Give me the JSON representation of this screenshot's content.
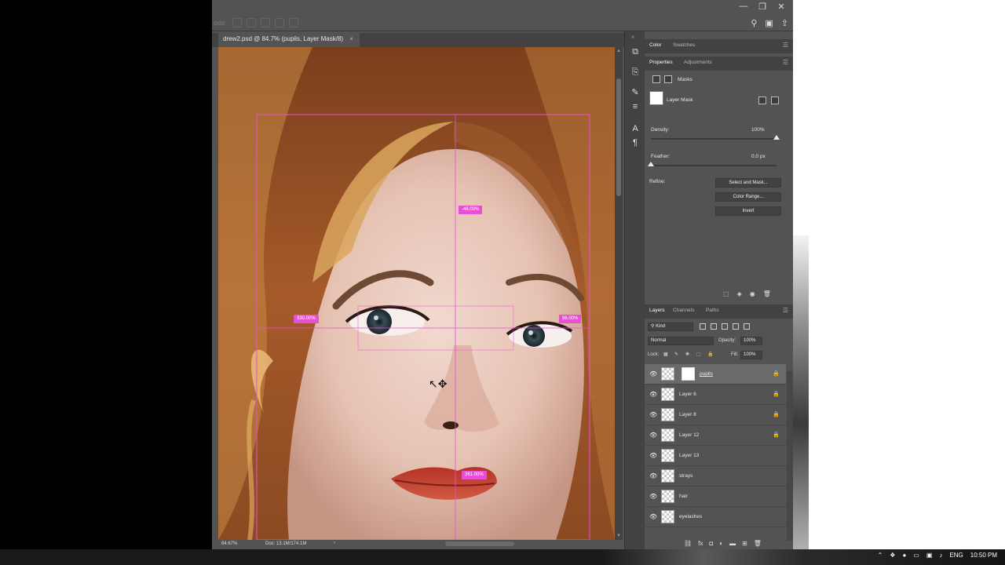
{
  "window": {
    "controls": {
      "minimize": "—",
      "restore": "❐",
      "close": "✕"
    },
    "options_faded": "ode"
  },
  "document": {
    "tab_title": "drew2.psd @ 84.7% (pupils, Layer Mask/8)",
    "close_glyph": "×",
    "zoom": "84.67%",
    "doc_size": "Doc: 13.1M/174.1M"
  },
  "transform": {
    "top_label": "-46.00%",
    "left_label": "330.00%",
    "right_label": "96.00%",
    "bottom_label": "361.00%"
  },
  "panels": {
    "color_tabs": [
      "Color",
      "Swatches"
    ],
    "properties_tabs": [
      "Properties",
      "Adjustments"
    ],
    "masks_title": "Masks",
    "layer_mask_label": "Layer Mask",
    "density_label": "Density:",
    "density_value": "100%",
    "density_level": 1.0,
    "feather_label": "Feather:",
    "feather_value": "0.0 px",
    "feather_level": 0.0,
    "refine_label": "Refine:",
    "buttons": {
      "select_and_mask": "Select and Mask...",
      "color_range": "Color Range...",
      "invert": "Invert"
    }
  },
  "layers": {
    "tabs": [
      "Layers",
      "Channels",
      "Paths"
    ],
    "kind": "Kind",
    "blend_mode": "Normal",
    "opacity_label": "Opacity:",
    "opacity_value": "100%",
    "lock_label": "Lock:",
    "fill_label": "Fill:",
    "fill_value": "100%",
    "items": [
      {
        "name": "pupils",
        "selected": true,
        "has_mask": true,
        "locked": true
      },
      {
        "name": "Layer 6",
        "selected": false,
        "has_mask": false,
        "locked": true
      },
      {
        "name": "Layer 8",
        "selected": false,
        "has_mask": false,
        "locked": true
      },
      {
        "name": "Layer 12",
        "selected": false,
        "has_mask": false,
        "locked": true
      },
      {
        "name": "Layer 13",
        "selected": false,
        "has_mask": false,
        "locked": false
      },
      {
        "name": "strays",
        "selected": false,
        "has_mask": false,
        "locked": false
      },
      {
        "name": "hair",
        "selected": false,
        "has_mask": false,
        "locked": false
      },
      {
        "name": "eyelashes",
        "selected": false,
        "has_mask": false,
        "locked": false
      }
    ]
  },
  "taskbar": {
    "language": "ENG",
    "time": "10:50 PM"
  },
  "colors": {
    "accent_magenta": "#e94fd6",
    "panel_bg": "#535353",
    "panel_dark": "#424242"
  }
}
